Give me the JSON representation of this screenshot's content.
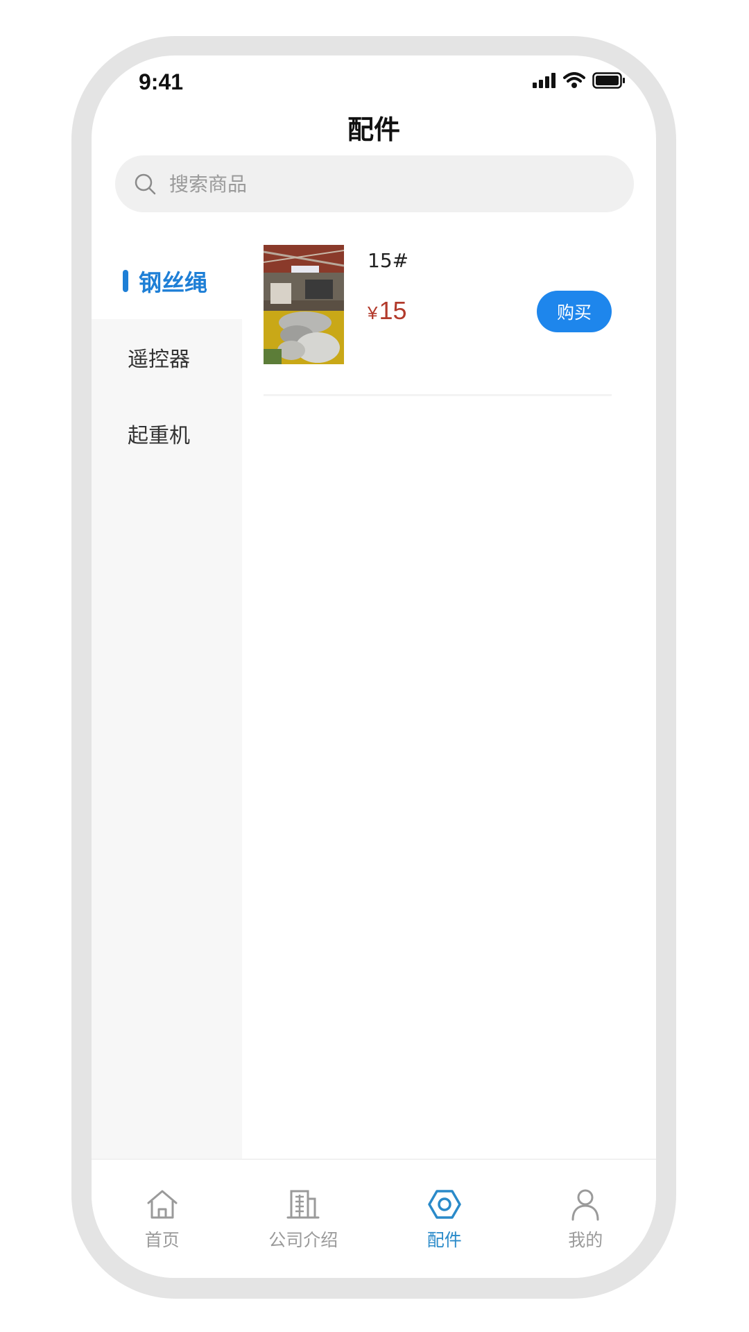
{
  "status_bar": {
    "time": "9:41"
  },
  "header": {
    "title": "配件"
  },
  "search": {
    "placeholder": "搜索商品"
  },
  "sidebar": {
    "items": [
      {
        "label": "钢丝绳",
        "active": true
      },
      {
        "label": "遥控器",
        "active": false
      },
      {
        "label": "起重机",
        "active": false
      }
    ]
  },
  "products": [
    {
      "name": "15#",
      "currency": "¥",
      "price": "15",
      "buy_label": "购买"
    }
  ],
  "tabbar": {
    "tabs": [
      {
        "label": "首页",
        "icon": "home-icon",
        "active": false
      },
      {
        "label": "公司介绍",
        "icon": "building-icon",
        "active": false
      },
      {
        "label": "配件",
        "icon": "hex-nut-icon",
        "active": true
      },
      {
        "label": "我的",
        "icon": "user-icon",
        "active": false
      }
    ]
  },
  "colors": {
    "accent": "#1e86ec",
    "active_text": "#1e7fd6",
    "price": "#b23a2b",
    "tab_active": "#2a8ac9"
  }
}
